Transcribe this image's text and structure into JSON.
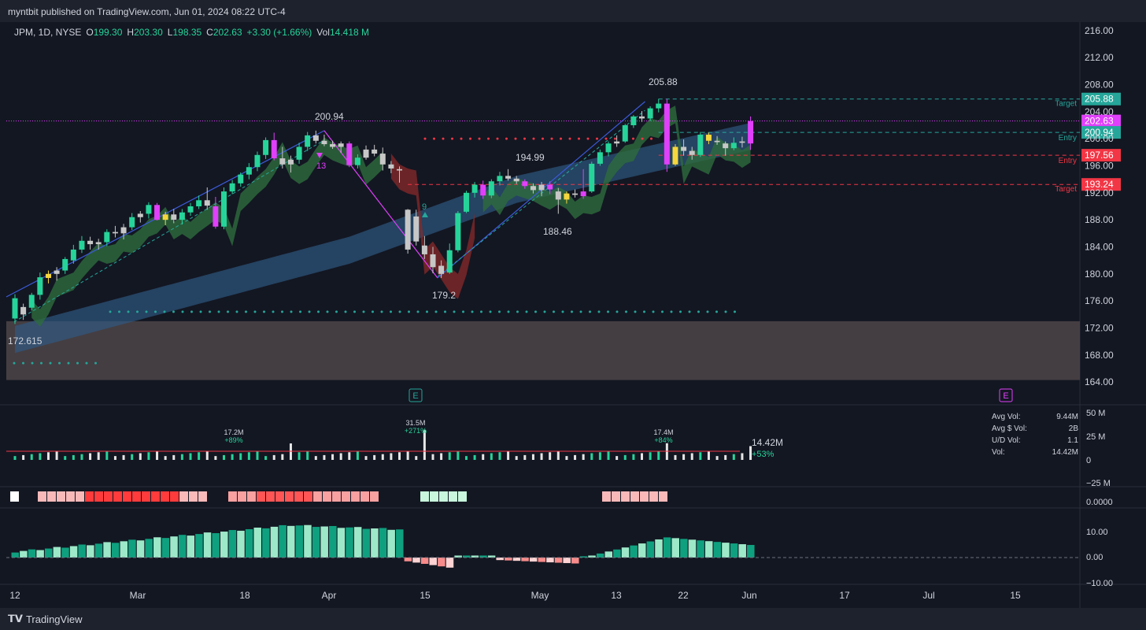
{
  "header": {
    "published": "myntbit published on TradingView.com, Jun 01, 2024 08:22 UTC-4"
  },
  "footer": {
    "brand": "TradingView"
  },
  "legend": {
    "symbol": "JPM, 1D, NYSE",
    "o_label": "O",
    "o_value": "199.30",
    "h_label": "H",
    "h_value": "203.30",
    "l_label": "L",
    "l_value": "198.35",
    "c_label": "C",
    "c_value": "202.63",
    "change": "+3.30 (+1.66%)",
    "vol_label": "Vol",
    "vol_value": "14.418 M"
  },
  "stats_panel": {
    "rows": [
      {
        "label": "Avg Vol:",
        "value": "9.44M"
      },
      {
        "label": "Avg $ Vol:",
        "value": "2B"
      },
      {
        "label": "U/D Vol:",
        "value": "1.1"
      },
      {
        "label": "Vol:",
        "value": "14.42M"
      }
    ]
  },
  "chart_data": {
    "type": "candlestick",
    "price_axis": {
      "ticks": [
        "216.00",
        "212.00",
        "208.00",
        "204.00",
        "200.00",
        "196.00",
        "192.00",
        "188.00",
        "184.00",
        "180.00",
        "176.00",
        "172.00",
        "168.00",
        "164.00"
      ],
      "ylim": [
        162.5,
        217.5
      ]
    },
    "time_axis": {
      "ticks": [
        "12",
        "Mar",
        "18",
        "Apr",
        "15",
        "May",
        "13",
        "22",
        "Jun",
        "17",
        "Jul",
        "15"
      ]
    },
    "candles": [
      [
        173.4,
        177.0,
        172.6,
        176.4,
        "g"
      ],
      [
        174.0,
        175.6,
        173.2,
        175.1,
        "w"
      ],
      [
        175.0,
        177.2,
        174.6,
        176.9,
        "g"
      ],
      [
        176.9,
        180.2,
        176.2,
        179.5,
        "g"
      ],
      [
        179.4,
        180.5,
        178.6,
        180.0,
        "y"
      ],
      [
        180.0,
        181.0,
        179.0,
        180.5,
        "w"
      ],
      [
        180.5,
        182.5,
        180.0,
        182.2,
        "g"
      ],
      [
        182.0,
        184.3,
        181.5,
        183.6,
        "g"
      ],
      [
        183.6,
        185.6,
        183.1,
        184.9,
        "g"
      ],
      [
        184.9,
        185.5,
        183.6,
        184.4,
        "w"
      ],
      [
        184.4,
        185.2,
        183.6,
        184.7,
        "w"
      ],
      [
        184.7,
        186.6,
        184.1,
        186.2,
        "g"
      ],
      [
        186.2,
        187.1,
        185.4,
        186.0,
        "w"
      ],
      [
        186.0,
        187.4,
        185.1,
        186.9,
        "w"
      ],
      [
        186.9,
        189.0,
        186.5,
        188.4,
        "g"
      ],
      [
        188.4,
        189.3,
        187.6,
        188.9,
        "w"
      ],
      [
        188.9,
        190.6,
        188.2,
        190.2,
        "g"
      ],
      [
        190.2,
        190.5,
        187.9,
        188.0,
        "m"
      ],
      [
        188.0,
        189.2,
        187.2,
        188.8,
        "y"
      ],
      [
        188.8,
        189.6,
        187.5,
        188.0,
        "w"
      ],
      [
        188.0,
        189.6,
        187.3,
        189.1,
        "g"
      ],
      [
        189.1,
        190.5,
        188.6,
        190.0,
        "g"
      ],
      [
        190.0,
        191.6,
        189.6,
        190.9,
        "g"
      ],
      [
        190.9,
        192.8,
        189.5,
        190.1,
        "w"
      ],
      [
        190.0,
        191.4,
        186.7,
        187.0,
        "m"
      ],
      [
        187.0,
        192.8,
        186.6,
        192.2,
        "g"
      ],
      [
        192.2,
        193.9,
        191.8,
        193.4,
        "g"
      ],
      [
        193.4,
        195.0,
        192.9,
        194.7,
        "g"
      ],
      [
        194.7,
        196.4,
        194.0,
        195.8,
        "g"
      ],
      [
        195.8,
        198.1,
        195.2,
        197.6,
        "g"
      ],
      [
        197.6,
        200.2,
        197.0,
        199.8,
        "g"
      ],
      [
        199.8,
        200.9,
        196.8,
        197.1,
        "m"
      ],
      [
        197.1,
        198.8,
        195.6,
        196.2,
        "w"
      ],
      [
        196.2,
        197.5,
        195.0,
        196.9,
        "w"
      ],
      [
        196.9,
        199.4,
        196.3,
        198.8,
        "g"
      ],
      [
        198.8,
        201.0,
        198.2,
        200.5,
        "g"
      ],
      [
        200.5,
        201.2,
        199.3,
        199.7,
        "w"
      ],
      [
        199.7,
        200.6,
        198.9,
        199.2,
        "w"
      ],
      [
        199.2,
        199.7,
        198.5,
        198.8,
        "w"
      ],
      [
        198.8,
        199.6,
        197.9,
        199.3,
        "w"
      ],
      [
        199.3,
        199.6,
        195.8,
        196.1,
        "m"
      ],
      [
        196.1,
        197.7,
        195.6,
        197.2,
        "g"
      ],
      [
        197.2,
        199.0,
        196.9,
        198.4,
        "w"
      ],
      [
        198.4,
        199.1,
        197.4,
        197.8,
        "w"
      ],
      [
        197.8,
        198.7,
        195.3,
        196.2,
        "w"
      ],
      [
        196.2,
        196.7,
        194.9,
        195.6,
        "w"
      ],
      [
        195.5,
        195.9,
        193.5,
        195.3,
        "w"
      ],
      [
        189.5,
        189.6,
        183.0,
        183.6,
        "w"
      ],
      [
        188.5,
        189.5,
        184.2,
        184.8,
        "w"
      ],
      [
        184.2,
        185.6,
        182.2,
        182.9,
        "w"
      ],
      [
        182.9,
        184.0,
        180.1,
        181.0,
        "w"
      ],
      [
        181.2,
        182.0,
        179.4,
        180.0,
        "w"
      ],
      [
        180.2,
        184.5,
        180.0,
        183.5,
        "g"
      ],
      [
        183.5,
        189.3,
        183.2,
        189.0,
        "g"
      ],
      [
        189.2,
        192.3,
        189.0,
        192.0,
        "g"
      ],
      [
        192.0,
        193.6,
        191.3,
        193.2,
        "g"
      ],
      [
        193.2,
        193.8,
        191.1,
        191.6,
        "m"
      ],
      [
        191.6,
        194.0,
        191.2,
        193.7,
        "g"
      ],
      [
        193.7,
        195.1,
        193.1,
        194.5,
        "g"
      ],
      [
        194.5,
        195.5,
        193.8,
        194.1,
        "w"
      ],
      [
        194.1,
        194.5,
        193.3,
        193.7,
        "w"
      ],
      [
        193.7,
        194.0,
        192.6,
        193.0,
        "m"
      ],
      [
        193.0,
        193.4,
        191.9,
        192.4,
        "w"
      ],
      [
        192.4,
        193.6,
        191.5,
        193.2,
        "w"
      ],
      [
        193.2,
        193.7,
        191.8,
        192.5,
        "m"
      ],
      [
        192.2,
        192.7,
        188.9,
        191.0,
        "w"
      ],
      [
        191.0,
        192.2,
        190.4,
        191.9,
        "y"
      ],
      [
        191.9,
        192.5,
        191.3,
        191.7,
        "w"
      ],
      [
        191.5,
        195.5,
        191.1,
        192.2,
        "m"
      ],
      [
        192.2,
        196.6,
        192.0,
        196.3,
        "g"
      ],
      [
        196.3,
        198.4,
        196.0,
        198.0,
        "g"
      ],
      [
        198.0,
        199.6,
        197.4,
        199.3,
        "g"
      ],
      [
        199.3,
        200.5,
        198.8,
        199.6,
        "w"
      ],
      [
        199.6,
        202.2,
        199.4,
        202.0,
        "g"
      ],
      [
        202.0,
        203.5,
        201.6,
        203.3,
        "g"
      ],
      [
        203.3,
        204.1,
        202.5,
        203.0,
        "w"
      ],
      [
        203.0,
        204.8,
        202.6,
        204.5,
        "g"
      ],
      [
        204.5,
        205.9,
        203.9,
        205.2,
        "g"
      ],
      [
        205.2,
        205.9,
        195.1,
        196.2,
        "m"
      ],
      [
        196.2,
        199.2,
        196.0,
        198.8,
        "y"
      ],
      [
        198.8,
        199.9,
        197.5,
        198.2,
        "w"
      ],
      [
        198.2,
        198.8,
        196.9,
        197.6,
        "w"
      ],
      [
        197.6,
        201.0,
        197.3,
        200.6,
        "g"
      ],
      [
        200.6,
        200.9,
        199.2,
        199.7,
        "y"
      ],
      [
        199.7,
        200.4,
        199.1,
        199.5,
        "w"
      ],
      [
        199.3,
        199.6,
        197.5,
        198.6,
        "w"
      ],
      [
        198.6,
        200.2,
        198.3,
        199.4,
        "g"
      ],
      [
        199.4,
        200.3,
        198.7,
        199.6,
        "w"
      ],
      [
        199.3,
        203.3,
        198.35,
        202.63,
        "m"
      ]
    ],
    "volume_labels": [
      {
        "value": "17.2M",
        "pct": "+89%"
      },
      {
        "value": "31.5M",
        "pct": "+271%"
      },
      {
        "value": "17.4M",
        "pct": "+84%"
      }
    ],
    "volume_last": {
      "value": "14.42M",
      "pct": "+53%"
    },
    "volume_axis": [
      "50 M",
      "25 M",
      "0",
      "−25 M"
    ],
    "osc_axis": [
      "10.00",
      "0.00",
      "−10.00"
    ],
    "strip_axis": "0.0000",
    "annotations": [
      {
        "text": "205.88",
        "price": 205.88
      },
      {
        "text": "200.94",
        "price": 200.94
      },
      {
        "text": "194.99",
        "price": 194.99
      },
      {
        "text": "188.46",
        "price": 188.46
      },
      {
        "text": "179.2",
        "price": 179.2
      },
      {
        "text": "172.615",
        "price": 172.615
      },
      {
        "text": "13"
      },
      {
        "text": "9"
      }
    ],
    "levels": [
      {
        "price": "205.88",
        "tag": "Target",
        "color": "#26a69a"
      },
      {
        "price": "202.63",
        "tag": "",
        "color": "#e040fb"
      },
      {
        "price": "200.94",
        "tag": "Entry",
        "color": "#26a69a"
      },
      {
        "price": "197.56",
        "tag": "Entry",
        "color": "#f23645"
      },
      {
        "price": "193.24",
        "tag": "Target",
        "color": "#f23645"
      }
    ],
    "earnings_markers": [
      {
        "text": "E",
        "color": "#26a69a"
      },
      {
        "text": "E",
        "color": "#e040fb"
      }
    ],
    "colors": {
      "green": "#26d49a",
      "white": "#c7c7c7",
      "magenta": "#e040fb",
      "yellow": "#f5d63d",
      "blue_band": "#2f5a86",
      "green_band": "#2e6b3d",
      "red_band": "#8a2a2a",
      "zone": "#4a4246"
    }
  }
}
